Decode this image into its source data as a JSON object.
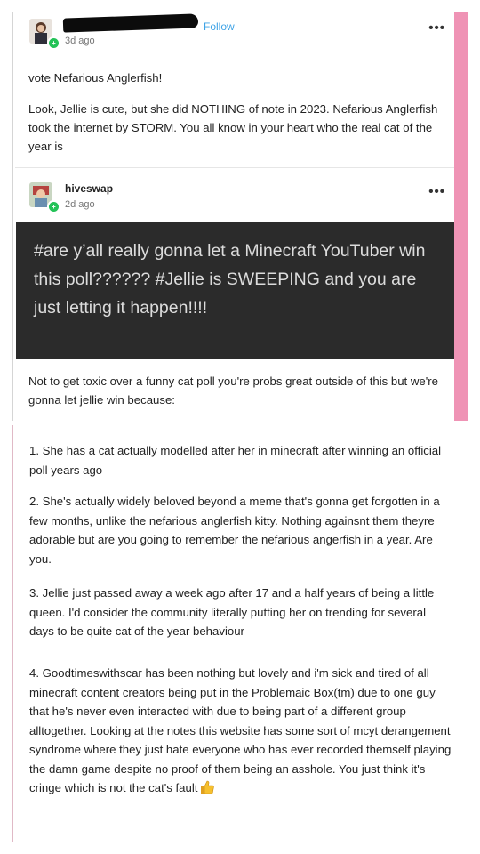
{
  "post1": {
    "follow_label": "Follow",
    "timestamp": "3d ago",
    "more_icon": "•••",
    "body": [
      "vote Nefarious Anglerfish!",
      "Look, Jellie is cute, but she did NOTHING of note in 2023. Nefarious Anglerfish took the internet by STORM. You all know in your heart who the real cat of the year is"
    ]
  },
  "post2": {
    "username": "hiveswap",
    "timestamp": "2d ago",
    "more_icon": "•••",
    "quote": "#are y’all really gonna let a Minecraft YouTuber win this poll?????? #Jellie is SWEEPING and you are just letting it happen!!!!",
    "body": "Not to get toxic over a funny cat poll you're probs great outside of this but we're gonna let jellie win because:"
  },
  "points": [
    "1. She has a cat actually modelled after her in minecraft after winning an official poll years ago",
    "2. She's actually widely beloved beyond a meme that's gonna get forgotten in a few months, unlike the nefarious anglerfish kitty. Nothing againsnt them theyre adorable but are you going to remember the nefarious angerfish in a year. Are you.",
    "3. Jellie just passed away a week ago after 17 and a half years of being a little queen. I'd consider the community literally putting her on trending for several days to be quite cat of the year behaviour",
    "4. Goodtimeswithscar has been nothing but lovely and i'm sick and tired of all minecraft content creators being put in the Problemaic Box(tm) due to one guy that he's never even interacted with due to being part of a different group alltogether. Looking at the notes this website has some sort of mcyt derangement syndrome where they just hate everyone who has ever recorded themself playing the damn game despite no proof of them being an asshole. You just think it's cringe which is not the cat's fault"
  ],
  "icons": {
    "thumbs_up": "thumbs-up-icon",
    "online_badge": "+"
  },
  "colors": {
    "pink_bar": "#ef93b5",
    "follow": "#3ea3e6",
    "online": "#23c257",
    "quote_bg": "#2b2b2b"
  }
}
